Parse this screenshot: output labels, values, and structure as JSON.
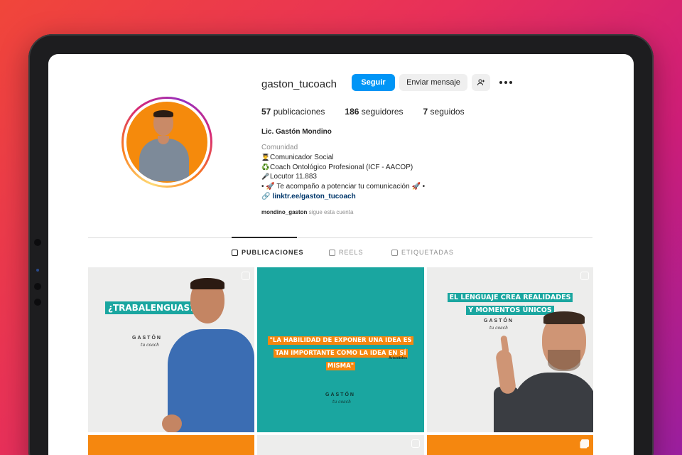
{
  "profile": {
    "username": "gaston_tucoach",
    "follow_label": "Seguir",
    "message_label": "Enviar mensaje",
    "stats": {
      "posts_count": "57",
      "posts_label": "publicaciones",
      "followers_count": "186",
      "followers_label": "seguidores",
      "following_count": "7",
      "following_label": "seguidos"
    },
    "full_name": "Lic. Gastón Mondino",
    "category": "Comunidad",
    "bio": [
      {
        "emoji": "👨‍🎓",
        "text": "Comunicador Social"
      },
      {
        "emoji": "♻️",
        "text": "Coach Ontológico Profesional (ICF - AACOP)"
      },
      {
        "emoji": "🎤",
        "text": "Locutor 11.883"
      },
      {
        "emoji": "",
        "text": "• 🚀 Te acompaño a potenciar tu comunicación 🚀 •"
      }
    ],
    "link": "linktr.ee/gaston_tucoach",
    "followed_by_user": "mondino_gaston",
    "followed_by_text": "sigue esta cuenta"
  },
  "tabs": [
    {
      "label": "PUBLICACIONES",
      "icon": "grid-icon",
      "active": true
    },
    {
      "label": "REELS",
      "icon": "reels-icon",
      "active": false
    },
    {
      "label": "ETIQUETADAS",
      "icon": "tagged-icon",
      "active": false
    }
  ],
  "posts": {
    "p1": {
      "headline": "¿TRABALENGUAS?",
      "logo": "GASTÓN",
      "logo_sub": "tu coach",
      "type_icon": "reel-icon"
    },
    "p2": {
      "quote": "\"LA HABILIDAD DE EXPONER UNA IDEA ES TAN IMPORTANTE COMO LA IDEA EN SÍ MISMA\"",
      "author": "Aristóteles",
      "logo": "GASTÓN",
      "logo_sub": "tu coach"
    },
    "p3": {
      "headline_line1": "EL LENGUAJE CREA REALIDADES",
      "headline_line2": "Y MOMENTOS ÚNICOS",
      "logo": "GASTÓN",
      "logo_sub": "tu coach",
      "type_icon": "reel-icon"
    }
  },
  "colors": {
    "follow_blue": "#0095f6",
    "brand_orange": "#f5870f",
    "brand_teal": "#1aa6a0"
  }
}
